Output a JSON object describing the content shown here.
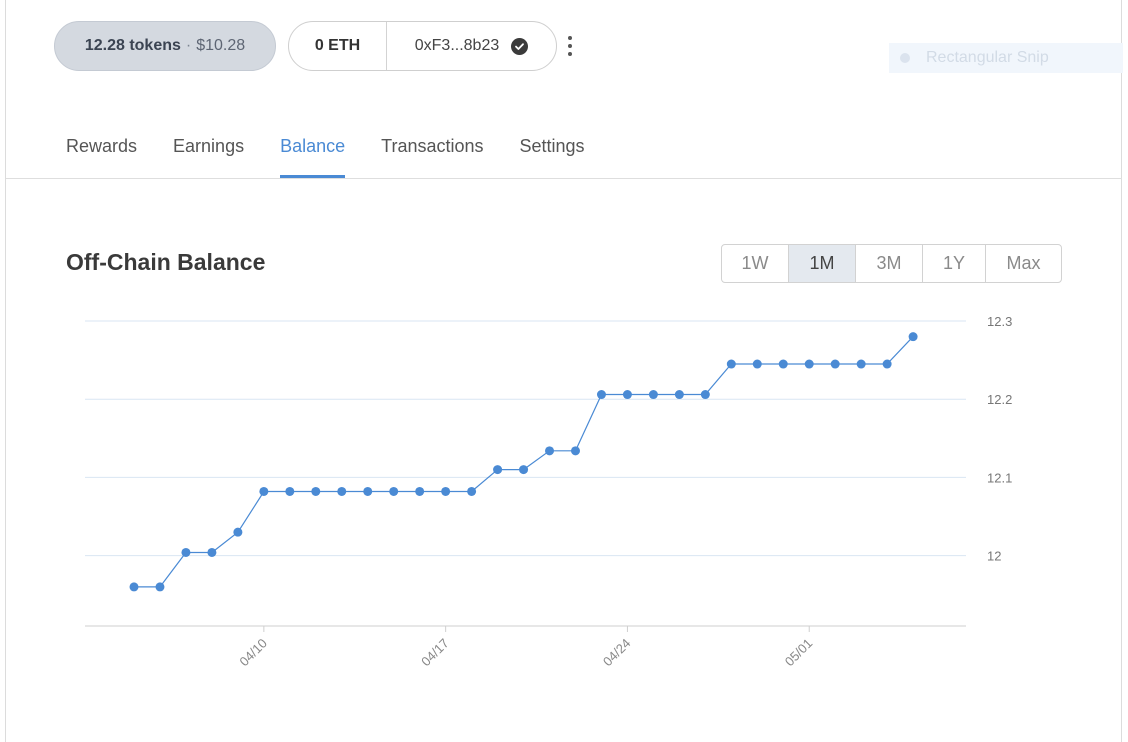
{
  "header": {
    "tokens_amount": "12.28 tokens",
    "tokens_separator": "·",
    "tokens_usd": "$10.28",
    "eth_balance": "0 ETH",
    "wallet_address": "0xF3...8b23",
    "snip_label": "Rectangular Snip"
  },
  "tabs": [
    {
      "label": "Rewards",
      "active": false
    },
    {
      "label": "Earnings",
      "active": false
    },
    {
      "label": "Balance",
      "active": true
    },
    {
      "label": "Transactions",
      "active": false
    },
    {
      "label": "Settings",
      "active": false
    }
  ],
  "chart_section": {
    "title": "Off-Chain Balance",
    "ranges": [
      "1W",
      "1M",
      "3M",
      "1Y",
      "Max"
    ],
    "active_range": "1M"
  },
  "colors": {
    "accent": "#4a8ad4",
    "line": "#4a8ad4",
    "gridline": "#d9e6f3"
  },
  "icons": [
    "check-circle-icon",
    "kebab-menu-icon"
  ],
  "chart_data": {
    "type": "line",
    "title": "",
    "xlabel": "",
    "ylabel": "",
    "x_tick_labels": [
      "04/10",
      "04/17",
      "04/24",
      "05/01"
    ],
    "y_tick_labels": [
      "12",
      "12.1",
      "12.2",
      "12.3"
    ],
    "ylim": [
      11.91,
      12.3
    ],
    "x": [
      "04/05",
      "04/06",
      "04/07",
      "04/08",
      "04/09",
      "04/10",
      "04/11",
      "04/12",
      "04/13",
      "04/14",
      "04/15",
      "04/16",
      "04/17",
      "04/18",
      "04/19",
      "04/20",
      "04/21",
      "04/22",
      "04/23",
      "04/24",
      "04/25",
      "04/26",
      "04/27",
      "04/28",
      "04/29",
      "04/30",
      "05/01",
      "05/02",
      "05/03",
      "05/04",
      "05/05"
    ],
    "series": [
      {
        "values": [
          11.96,
          11.96,
          12.004,
          12.004,
          12.03,
          12.082,
          12.082,
          12.082,
          12.082,
          12.082,
          12.082,
          12.082,
          12.082,
          12.082,
          12.11,
          12.11,
          12.134,
          12.134,
          12.206,
          12.206,
          12.206,
          12.206,
          12.206,
          12.245,
          12.245,
          12.245,
          12.245,
          12.245,
          12.245,
          12.245,
          12.28
        ]
      }
    ],
    "grid": true,
    "legend": "none"
  }
}
